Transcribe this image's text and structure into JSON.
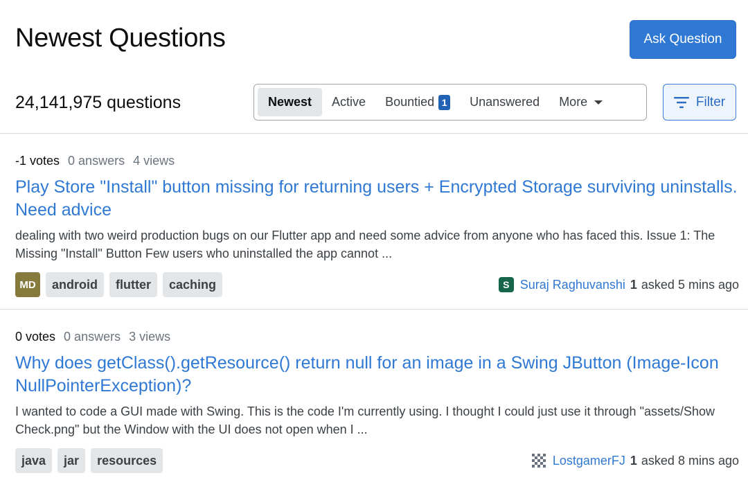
{
  "header": {
    "title": "Newest Questions",
    "ask_button": "Ask Question"
  },
  "count_label": "24,141,975 questions",
  "tabs": [
    {
      "label": "Newest",
      "active": true
    },
    {
      "label": "Active"
    },
    {
      "label": "Bountied",
      "badge": "1"
    },
    {
      "label": "Unanswered"
    },
    {
      "label": "More",
      "icon": "caret-down-icon"
    }
  ],
  "filter_button": {
    "label": "Filter",
    "icon": "filter-icon"
  },
  "questions": [
    {
      "votes": "-1 votes",
      "answers": "0 answers",
      "views": "4 views",
      "title": "Play Store \"Install\" button missing for returning users + Encrypted Storage surviving uninstalls. Need advice",
      "excerpt": "dealing with two weird production bugs on our Flutter app and need some advice from anyone who has faced this. Issue 1: The Missing \"Install\" Button Few users who uninstalled the app cannot ...",
      "tag_avatar": "MD",
      "tags": [
        "android",
        "flutter",
        "caching"
      ],
      "user": {
        "avatar_letter": "S",
        "name": "Suraj Raghuvanshi",
        "reputation": "1",
        "asked": "asked 5 mins ago"
      }
    },
    {
      "votes": "0 votes",
      "answers": "0 answers",
      "views": "3 views",
      "title": "Why does getClass().getResource() return null for an image in a Swing JButton (Image-Icon NullPointerException)?",
      "excerpt": "I wanted to code a GUI made with Swing. This is the code I'm currently using. I thought I could just use it through \"assets/Show Check.png\" but the Window with the UI does not open when I ...",
      "tags": [
        "java",
        "jar",
        "resources"
      ],
      "user": {
        "avatar": "identicon-avatar",
        "name": "LostgamerFJ",
        "reputation": "1",
        "asked": "asked 8 mins ago"
      }
    }
  ],
  "colors": {
    "accent": "#2f78d4",
    "badge": "#2162b5",
    "tag_bg": "#e3e6e8",
    "user_avatar": "#17664a",
    "md_avatar": "#867a3d"
  }
}
